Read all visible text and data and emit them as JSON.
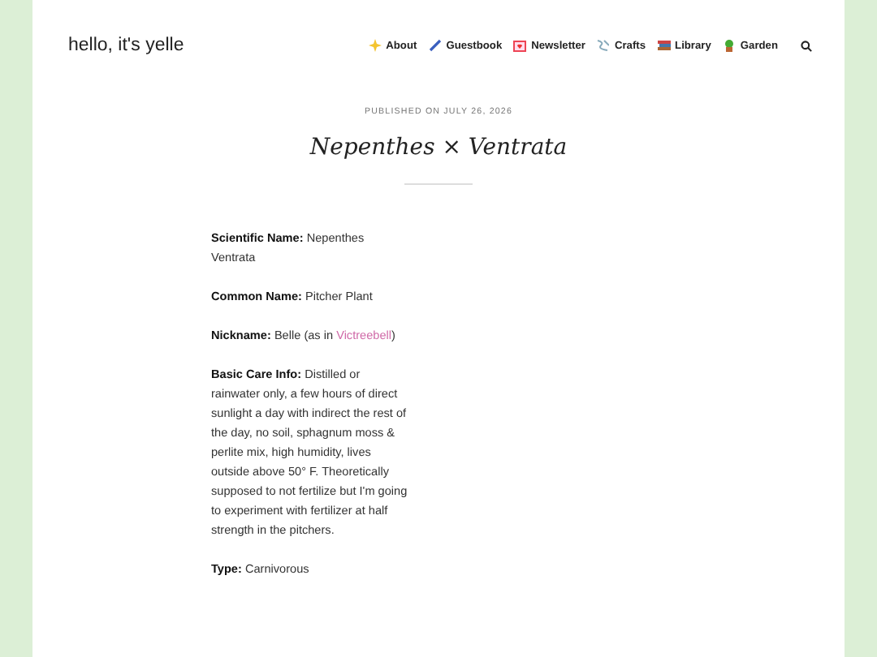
{
  "site_title": "hello, it's yelle",
  "nav": [
    {
      "label": "About"
    },
    {
      "label": "Guestbook"
    },
    {
      "label": "Newsletter"
    },
    {
      "label": "Crafts"
    },
    {
      "label": "Library"
    },
    {
      "label": "Garden"
    }
  ],
  "post": {
    "published": "PUBLISHED ON JULY 26, 2026",
    "title": "Nepenthes × Ventrata",
    "fields": [
      {
        "label": "Scientific Name:",
        "value": "Nepenthes Ventrata"
      },
      {
        "label": "Common Name:",
        "value": "Pitcher Plant"
      },
      {
        "label": "Nickname:",
        "value": "Belle (as in",
        "link": "Victreebell",
        "after": ")"
      },
      {
        "label": "Basic Care Info:",
        "value": "Distilled or rainwater only, a few hours of direct sunlight a day with indirect the rest of the day, no soil, sphagnum moss & perlite mix, high humidity, lives outside above 50° F. Theoretically supposed to not fertilize but I'm going to experiment with fertilizer at half strength in the pitchers."
      },
      {
        "label": "Type:",
        "value": "Carnivorous"
      }
    ]
  }
}
